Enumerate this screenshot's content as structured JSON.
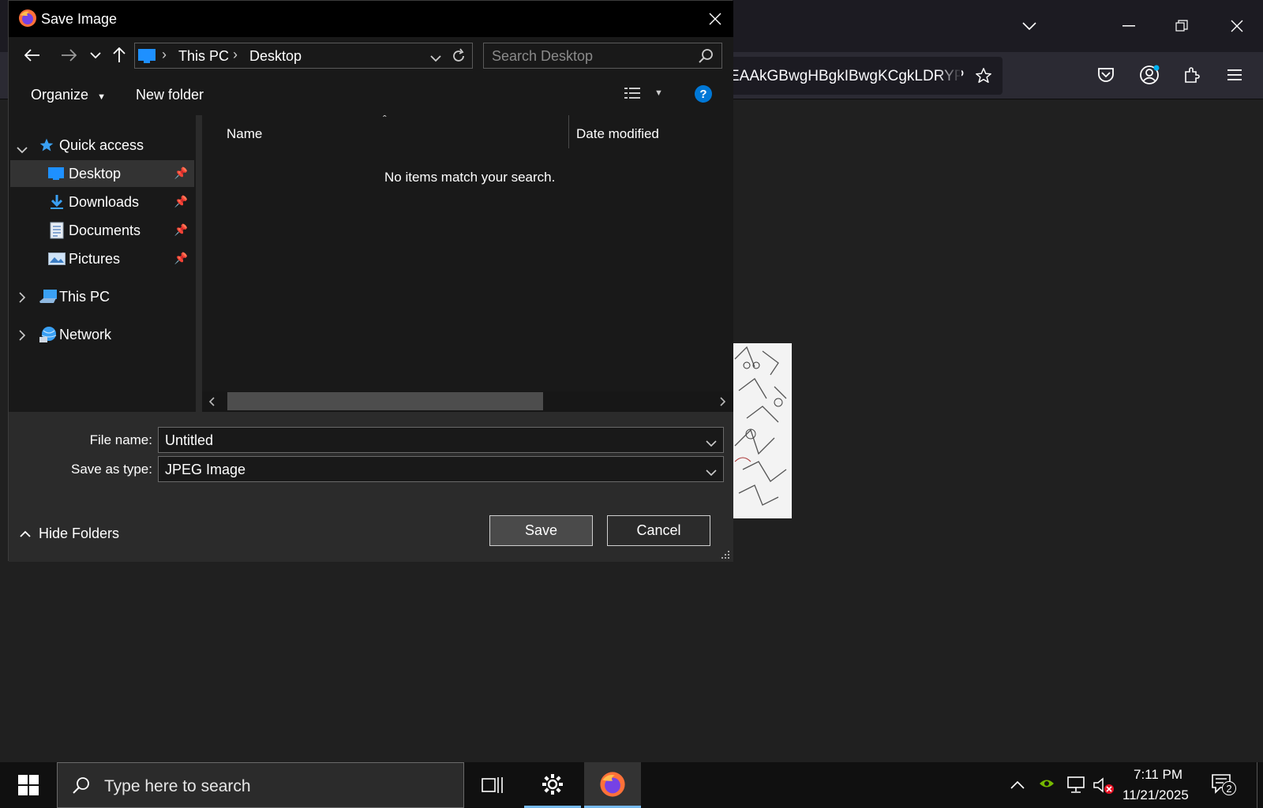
{
  "browser": {
    "url_fragment": "EAAkGBwgHBgkIBwgKCgkLDRYP"
  },
  "dialog": {
    "title": "Save Image",
    "breadcrumb": [
      "This PC",
      "Desktop"
    ],
    "search_placeholder": "Search Desktop",
    "organize_label": "Organize",
    "new_folder_label": "New folder",
    "help_glyph": "?",
    "nav_tree": {
      "quick_access": "Quick access",
      "items": [
        {
          "label": "Desktop",
          "icon": "desktop-folder-icon",
          "pinned": true,
          "selected": true
        },
        {
          "label": "Downloads",
          "icon": "downloads-icon",
          "pinned": true
        },
        {
          "label": "Documents",
          "icon": "documents-icon",
          "pinned": true
        },
        {
          "label": "Pictures",
          "icon": "pictures-icon",
          "pinned": true
        }
      ],
      "this_pc": "This PC",
      "network": "Network"
    },
    "columns": {
      "name": "Name",
      "date_modified": "Date modified"
    },
    "empty_message": "No items match your search.",
    "file_name_label": "File name:",
    "file_name_value": "Untitled",
    "save_as_type_label": "Save as type:",
    "save_as_type_value": "JPEG Image",
    "hide_folders_label": "Hide Folders",
    "save_label": "Save",
    "cancel_label": "Cancel"
  },
  "taskbar": {
    "search_placeholder": "Type here to search",
    "time": "7:11 PM",
    "date": "11/21/2025",
    "notification_count": "2"
  },
  "colors": {
    "accent": "#0078d7",
    "dialog_bg": "#2b2b2b",
    "pane_bg": "#191919"
  }
}
